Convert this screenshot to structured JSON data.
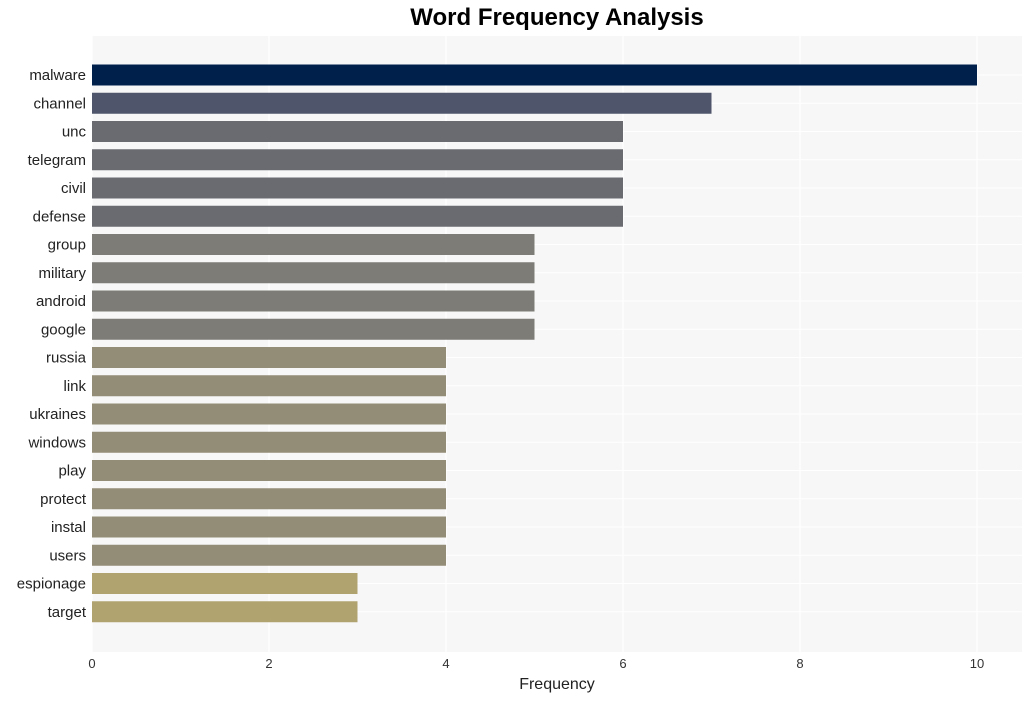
{
  "chart_data": {
    "type": "bar",
    "orientation": "horizontal",
    "title": "Word Frequency Analysis",
    "xlabel": "Frequency",
    "ylabel": "",
    "xlim": [
      0,
      10.5
    ],
    "xticks": [
      0,
      2,
      4,
      6,
      8,
      10
    ],
    "grid": true,
    "categories": [
      "malware",
      "channel",
      "unc",
      "telegram",
      "civil",
      "defense",
      "group",
      "military",
      "android",
      "google",
      "russia",
      "link",
      "ukraines",
      "windows",
      "play",
      "protect",
      "instal",
      "users",
      "espionage",
      "target"
    ],
    "values": [
      10,
      7,
      6,
      6,
      6,
      6,
      5,
      5,
      5,
      5,
      4,
      4,
      4,
      4,
      4,
      4,
      4,
      4,
      3,
      3
    ],
    "colors": [
      "#00204c",
      "#4f566b",
      "#696b70",
      "#696b70",
      "#696b70",
      "#696b70",
      "#7d7c77",
      "#7d7c77",
      "#7d7c77",
      "#7d7c77",
      "#938c76",
      "#938c76",
      "#938c76",
      "#938c76",
      "#938c76",
      "#938c76",
      "#938c76",
      "#938c76",
      "#b1a370",
      "#b1a370"
    ]
  }
}
